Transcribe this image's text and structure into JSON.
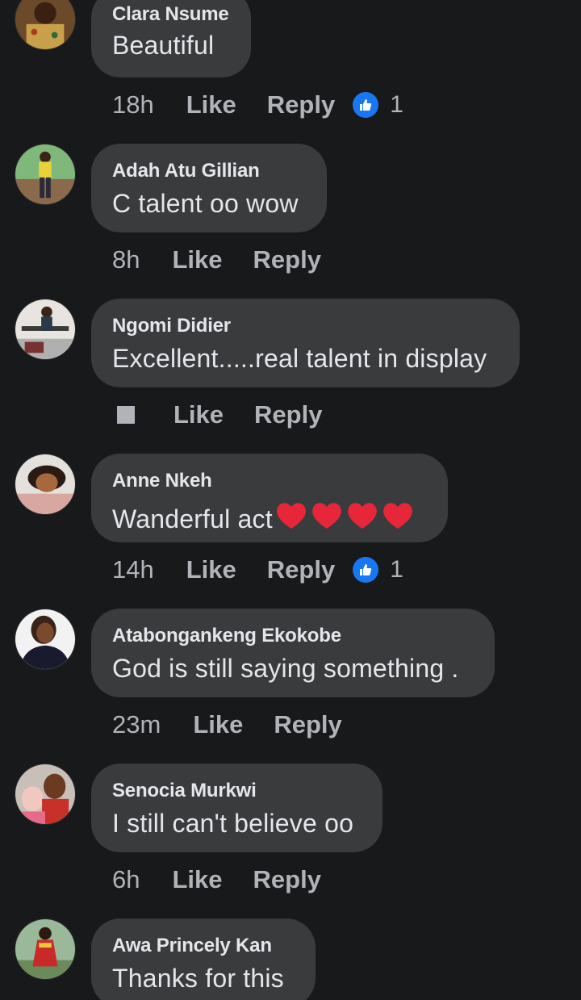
{
  "comments": [
    {
      "name": "Clara Nsume",
      "text": "Beautiful",
      "time": "18h",
      "like_label": "Like",
      "reply_label": "Reply",
      "reaction_icon": "like-reaction-icon",
      "reaction_count": "1"
    },
    {
      "name": "Adah Atu Gillian",
      "text": "C talent oo wow",
      "time": "8h",
      "like_label": "Like",
      "reply_label": "Reply"
    },
    {
      "name": "Ngomi Didier",
      "text": "Excellent.....real talent in display",
      "time_icon": "square-icon",
      "like_label": "Like",
      "reply_label": "Reply"
    },
    {
      "name": "Anne Nkeh",
      "text": "Wanderful act",
      "emoji": "red-heart x4",
      "time": "14h",
      "like_label": "Like",
      "reply_label": "Reply",
      "reaction_icon": "like-reaction-icon",
      "reaction_count": "1"
    },
    {
      "name": "Atabongankeng Ekokobe",
      "text": "God is still saying something .",
      "time": "23m",
      "like_label": "Like",
      "reply_label": "Reply"
    },
    {
      "name": "Senocia Murkwi",
      "text": "I still can't believe oo",
      "time": "6h",
      "like_label": "Like",
      "reply_label": "Reply"
    },
    {
      "name": "Awa Princely Kan",
      "text": "Thanks for this"
    }
  ],
  "colors": {
    "background": "#18191a",
    "bubble": "#3a3b3c",
    "primary_text": "#e4e6eb",
    "secondary_text": "#b0b3b8",
    "like_blue": "#1877f2",
    "heart_red": "#e8263a"
  }
}
